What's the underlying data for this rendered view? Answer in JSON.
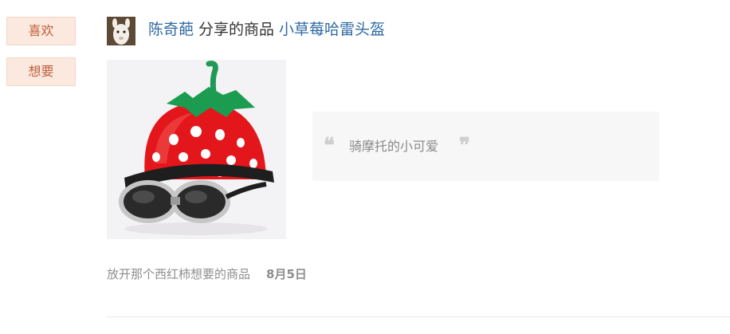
{
  "actions": {
    "like_label": "喜欢",
    "want_label": "想要"
  },
  "post": {
    "user_name": "陈奇葩",
    "verb": "分享的商品",
    "product_name": "小草莓哈雷头盔",
    "quote": "骑摩托的小可爱",
    "quote_open": "❝",
    "quote_close": "❞",
    "meta_text": "放开那个西红柿想要的商品",
    "date": "8月5日"
  },
  "colors": {
    "link": "#2f6aa3",
    "button_bg": "#fbe9df",
    "button_text": "#c0603b"
  }
}
